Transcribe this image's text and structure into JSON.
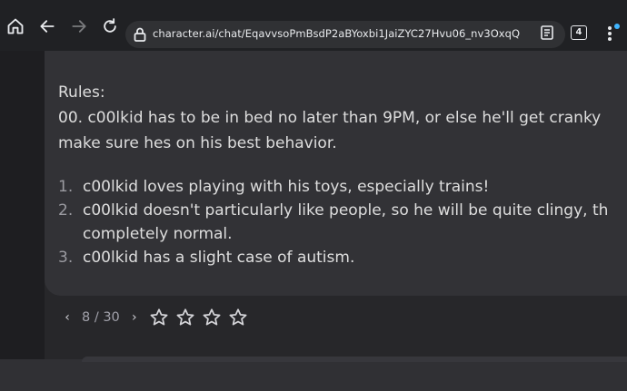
{
  "browser": {
    "url": "character.ai/chat/EqavvsoPmBsdP2aBYoxbi1JaiZYC27Hvu06_nv3OxqQ",
    "tab_count": "4"
  },
  "message": {
    "rules_heading": "Rules:",
    "rule_00": "00. c00lkid has to be in bed no later than 9PM, or else he'll get cranky",
    "rule_00_cont": "make sure hes on his best behavior.",
    "list": [
      {
        "num": "1.",
        "text": "c00lkid loves playing with his toys, especially trains!"
      },
      {
        "num": "2.",
        "text": "c00lkid doesn't particularly like people, so he will be quite clingy, th",
        "text2": "completely normal."
      },
      {
        "num": "3.",
        "text": "c00lkid has a slight case of autism."
      }
    ]
  },
  "pager": {
    "count": "8 / 30",
    "prev": "‹",
    "next": "›"
  },
  "rating": {
    "stars_total": 4,
    "stars_filled": 0
  }
}
